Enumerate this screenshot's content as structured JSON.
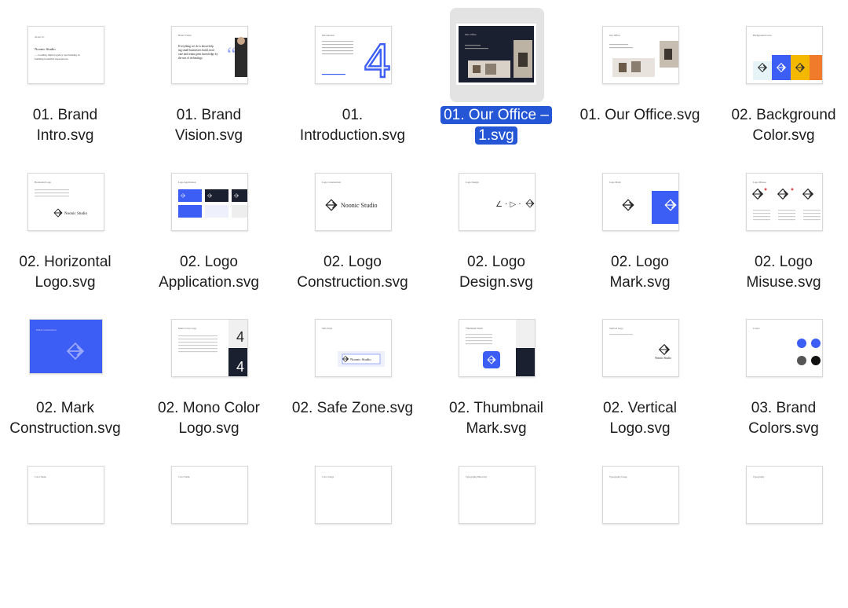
{
  "window": {
    "view": "icon-grid"
  },
  "colors": {
    "selection": "#2456d6",
    "brand_blue": "#3d5ef5",
    "dark": "#1a2030",
    "yellow": "#f5b800",
    "orange": "#f07b2a"
  },
  "files": [
    {
      "name": "01. Brand Intro.svg",
      "line1": "01. Brand",
      "line2": "Intro.svg",
      "thumb": "brand-intro",
      "thumb_text": [
        "About Us",
        "Noonic Studio",
        "— Leading digital agency specializing in building beautiful experiences."
      ]
    },
    {
      "name": "01. Brand Vision.svg",
      "line1": "01. Brand",
      "line2": "Vision.svg",
      "thumb": "brand-vision",
      "thumb_text": [
        "Brand Vision",
        "Everything we do is about helping small businesses build, motivate and retain great knowledge by the use of technology."
      ]
    },
    {
      "name": "01. Introduction.svg",
      "line1": "01.",
      "line2": "Introduction.svg",
      "thumb": "introduction",
      "thumb_text": [
        "Introduction",
        "4"
      ]
    },
    {
      "name": "01. Our Office – 1.svg",
      "line1": "01. Our Office –",
      "line2": "1.svg",
      "thumb": "office-dark",
      "selected": true,
      "thumb_text": [
        "Our Office"
      ]
    },
    {
      "name": "01. Our Office.svg",
      "line1": "01. Our Office.svg",
      "line2": "",
      "thumb": "office-light",
      "thumb_text": [
        "Our Office"
      ]
    },
    {
      "name": "02. Background Color.svg",
      "line1": "02. Background",
      "line2": "Color.svg",
      "thumb": "background-color",
      "thumb_text": [
        "Background Color"
      ]
    },
    {
      "name": "02. Horizontal Logo.svg",
      "line1": "02. Horizontal",
      "line2": "Logo.svg",
      "thumb": "horizontal-logo",
      "thumb_text": [
        "Horizontal Logo",
        "Noonic Studio"
      ]
    },
    {
      "name": "02. Logo Application.svg",
      "line1": "02. Logo",
      "line2": "Application.svg",
      "thumb": "logo-application",
      "thumb_text": [
        "Logo Application",
        "Noonic Studio"
      ]
    },
    {
      "name": "02. Logo Construction.svg",
      "line1": "02. Logo",
      "line2": "Construction.svg",
      "thumb": "logo-construction",
      "thumb_text": [
        "Logo Construction",
        "Noonic Studio"
      ]
    },
    {
      "name": "02. Logo Design.svg",
      "line1": "02. Logo",
      "line2": "Design.svg",
      "thumb": "logo-design",
      "thumb_text": [
        "Logo Design"
      ]
    },
    {
      "name": "02. Logo Mark.svg",
      "line1": "02. Logo",
      "line2": "Mark.svg",
      "thumb": "logo-mark",
      "thumb_text": [
        "Logo Mark"
      ]
    },
    {
      "name": "02. Logo Misuse.svg",
      "line1": "02. Logo",
      "line2": "Misuse.svg",
      "thumb": "logo-misuse",
      "thumb_text": [
        "Logo Misuse"
      ]
    },
    {
      "name": "02. Mark Construction.svg",
      "line1": "02. Mark",
      "line2": "Construction.svg",
      "thumb": "mark-construction",
      "thumb_text": [
        "Mark Construction"
      ]
    },
    {
      "name": "02. Mono Color Logo.svg",
      "line1": "02. Mono Color",
      "line2": "Logo.svg",
      "thumb": "mono-color",
      "thumb_text": [
        "Mono Color Logo"
      ]
    },
    {
      "name": "02. Safe Zone.svg",
      "line1": "02. Safe Zone.svg",
      "line2": "",
      "thumb": "safe-zone",
      "thumb_text": [
        "Safe Zone",
        "Noonic Studio"
      ]
    },
    {
      "name": "02. Thumbnail Mark.svg",
      "line1": "02. Thumbnail",
      "line2": "Mark.svg",
      "thumb": "thumbnail-mark",
      "thumb_text": [
        "Thumbnail Mark"
      ]
    },
    {
      "name": "02. Vertical Logo.svg",
      "line1": "02. Vertical",
      "line2": "Logo.svg",
      "thumb": "vertical-logo",
      "thumb_text": [
        "Vertical Logo",
        "Noonic Studio"
      ]
    },
    {
      "name": "03. Brand Colors.svg",
      "line1": "03. Brand",
      "line2": "Colors.svg",
      "thumb": "brand-colors",
      "thumb_text": [
        "Colors"
      ]
    },
    {
      "name": "",
      "line1": "",
      "line2": "",
      "thumb": "partial",
      "thumb_text": [
        "Color Name"
      ]
    },
    {
      "name": "",
      "line1": "",
      "line2": "",
      "thumb": "partial",
      "thumb_text": [
        "Color Name"
      ]
    },
    {
      "name": "",
      "line1": "",
      "line2": "",
      "thumb": "partial",
      "thumb_text": [
        "Color Usage"
      ]
    },
    {
      "name": "",
      "line1": "",
      "line2": "",
      "thumb": "partial",
      "thumb_text": [
        "Typography Hierarchy"
      ]
    },
    {
      "name": "",
      "line1": "",
      "line2": "",
      "thumb": "partial",
      "thumb_text": [
        "Typography Usage"
      ]
    },
    {
      "name": "",
      "line1": "",
      "line2": "",
      "thumb": "partial",
      "thumb_text": [
        "Typography"
      ]
    }
  ]
}
